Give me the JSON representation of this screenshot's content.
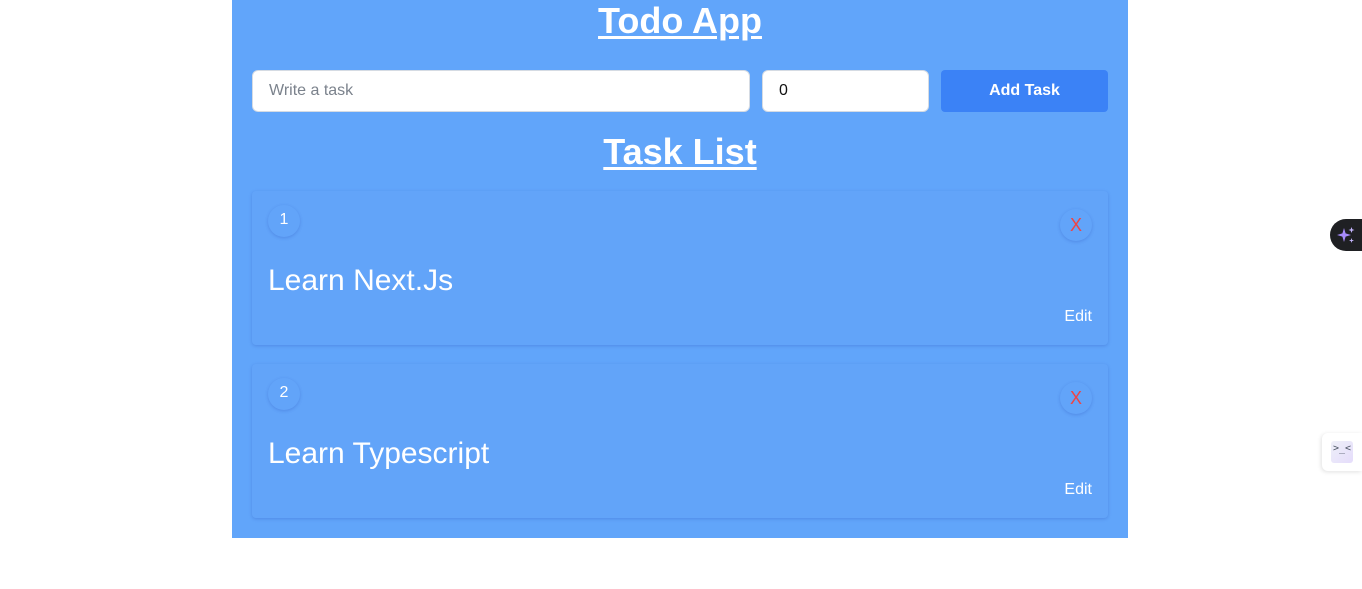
{
  "app": {
    "title": "Todo App",
    "background_color": "#61a5fa"
  },
  "form": {
    "task_placeholder": "Write a task",
    "task_value": "",
    "number_value": "0",
    "add_button_label": "Add Task",
    "button_color": "#3b82f6"
  },
  "list": {
    "title": "Task List",
    "tasks": [
      {
        "number": "1",
        "text": "Learn Next.Js",
        "delete_label": "X",
        "edit_label": "Edit"
      },
      {
        "number": "2",
        "text": "Learn Typescript",
        "delete_label": "X",
        "edit_label": "Edit"
      }
    ],
    "delete_color": "#ef4444"
  },
  "extensions": {
    "ai_icon": "sparkles-icon",
    "dev_icon": "devtools-icon",
    "dev_glyph": ">_<"
  }
}
